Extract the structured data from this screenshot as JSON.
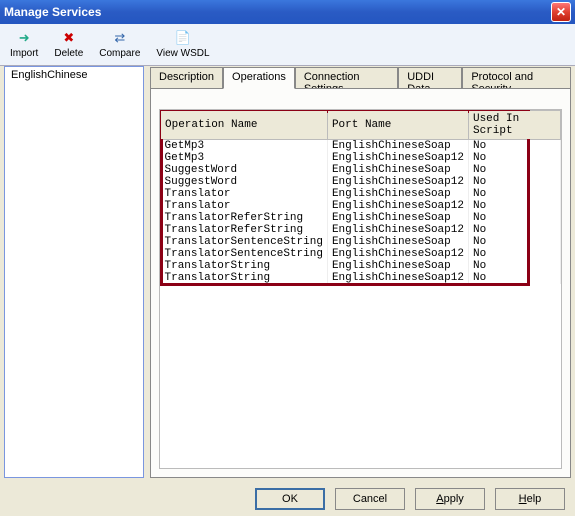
{
  "window": {
    "title": "Manage Services"
  },
  "toolbar": {
    "import": "Import",
    "delete": "Delete",
    "compare": "Compare",
    "view_wsdl": "View WSDL"
  },
  "sidebar": {
    "items": [
      "EnglishChinese"
    ]
  },
  "tabs": {
    "items": [
      "Description",
      "Operations",
      "Connection Settings",
      "UDDI Data",
      "Protocol and Security"
    ],
    "active_index": 1
  },
  "table": {
    "headers": [
      "Operation Name",
      "Port Name",
      "Used In Script"
    ],
    "rows": [
      {
        "op": "GetMp3",
        "port": "EnglishChineseSoap",
        "used": "No"
      },
      {
        "op": "GetMp3",
        "port": "EnglishChineseSoap12",
        "used": "No"
      },
      {
        "op": "SuggestWord",
        "port": "EnglishChineseSoap",
        "used": "No"
      },
      {
        "op": "SuggestWord",
        "port": "EnglishChineseSoap12",
        "used": "No"
      },
      {
        "op": "Translator",
        "port": "EnglishChineseSoap",
        "used": "No"
      },
      {
        "op": "Translator",
        "port": "EnglishChineseSoap12",
        "used": "No"
      },
      {
        "op": "TranslatorReferString",
        "port": "EnglishChineseSoap",
        "used": "No"
      },
      {
        "op": "TranslatorReferString",
        "port": "EnglishChineseSoap12",
        "used": "No"
      },
      {
        "op": "TranslatorSentenceString",
        "port": "EnglishChineseSoap",
        "used": "No"
      },
      {
        "op": "TranslatorSentenceString",
        "port": "EnglishChineseSoap12",
        "used": "No"
      },
      {
        "op": "TranslatorString",
        "port": "EnglishChineseSoap",
        "used": "No"
      },
      {
        "op": "TranslatorString",
        "port": "EnglishChineseSoap12",
        "used": "No"
      }
    ]
  },
  "footer": {
    "ok": "OK",
    "cancel": "Cancel",
    "apply": "Apply",
    "help": "Help"
  }
}
